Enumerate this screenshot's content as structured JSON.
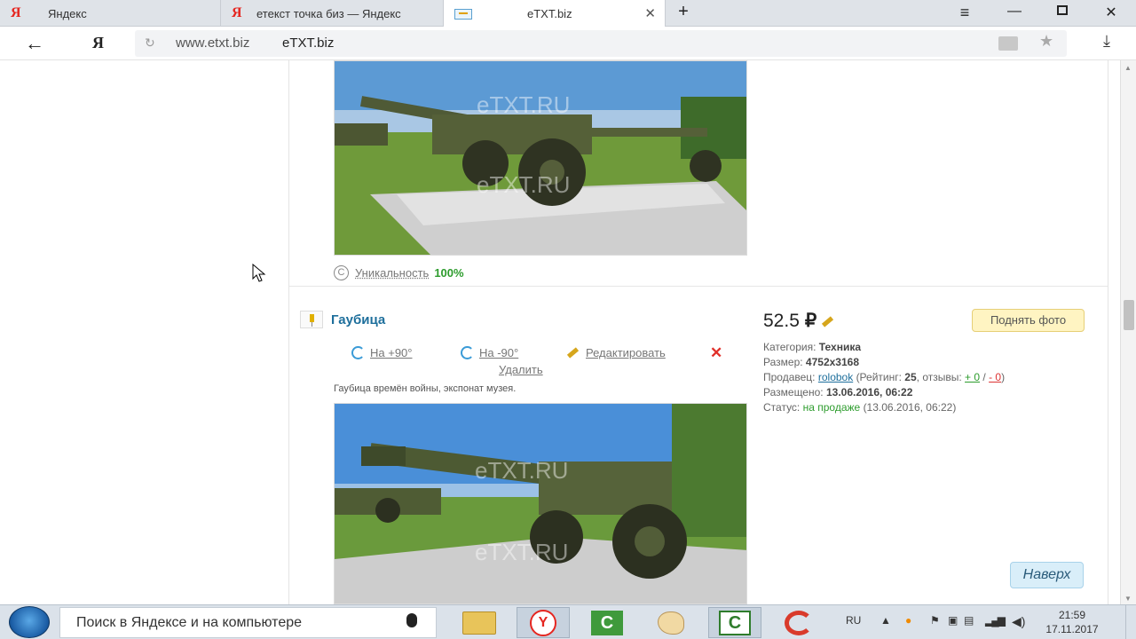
{
  "browser": {
    "tabs": [
      {
        "label": "Яндекс",
        "icon": "yandex-icon"
      },
      {
        "label": "етекст точка биз — Яндекс",
        "icon": "yandex-icon"
      },
      {
        "label": "eTXT.biz",
        "icon": "etxt-icon"
      }
    ],
    "new_tab": "+",
    "address": {
      "url": "www.etxt.biz",
      "page_title": "eTXT.biz",
      "yandex_logo": "Я"
    }
  },
  "page": {
    "first_item": {
      "uniqueness_label": "Уникальность",
      "uniqueness_value": "100%",
      "watermark": "eTXT.RU"
    },
    "item": {
      "title": "Гаубица",
      "rotate_plus": "На +90°",
      "rotate_minus": "На -90°",
      "edit": "Редактировать",
      "delete": "Удалить",
      "description": "Гаубица времён войны, экспонат музея.",
      "price": "52.5",
      "currency": "₽",
      "raise_button": "Поднять фото",
      "meta": {
        "category_label": "Категория:",
        "category": "Техника",
        "size_label": "Размер:",
        "size": "4752x3168",
        "seller_label": "Продавец:",
        "seller": "rolobok",
        "rating_label": "(Рейтинг:",
        "rating": "25",
        "reviews_label": ", отзывы:",
        "reviews_pos": "+ 0",
        "reviews_sep": "/",
        "reviews_neg": "- 0",
        "reviews_close": ")",
        "placed_label": "Размещено:",
        "placed": "13.06.2016, 06:22",
        "status_label": "Статус:",
        "status": "на продаже",
        "status_date": "(13.06.2016, 06:22)"
      }
    },
    "to_top": "Наверх"
  },
  "taskbar": {
    "search_placeholder": "Поиск в Яндексе и на компьютере",
    "lang": "RU",
    "time": "21:59",
    "date": "17.11.2017"
  }
}
